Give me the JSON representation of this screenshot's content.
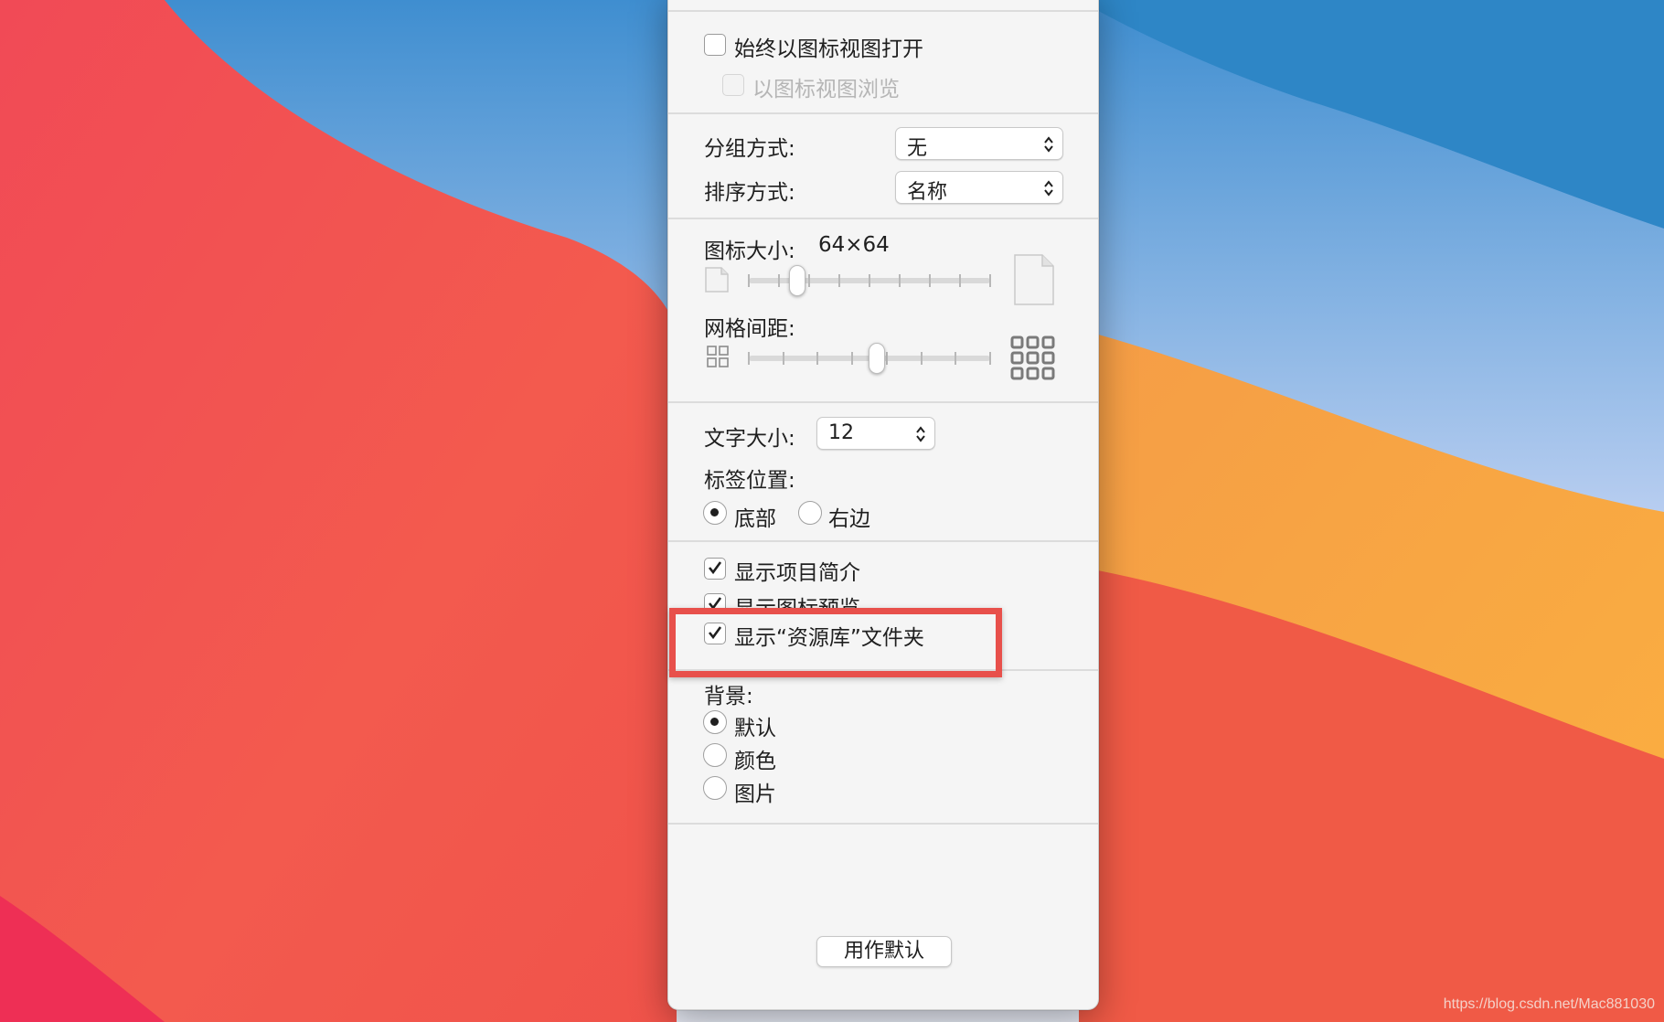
{
  "view_options": {
    "always_open_icon_view": {
      "label": "始终以图标视图打开",
      "checked": false
    },
    "browse_icon_view": {
      "label": "以图标视图浏览",
      "checked": false,
      "disabled": true
    },
    "group_by": {
      "label": "分组方式:",
      "value": "无"
    },
    "sort_by": {
      "label": "排序方式:",
      "value": "名称"
    },
    "icon_size": {
      "label": "图标大小:",
      "value": "64×64",
      "slider_fraction": 0.2
    },
    "grid_spacing": {
      "label": "网格间距:",
      "slider_fraction": 0.53
    },
    "text_size": {
      "label": "文字大小:",
      "value": "12"
    },
    "label_position": {
      "label": "标签位置:",
      "options": [
        {
          "label": "底部",
          "selected": true
        },
        {
          "label": "右边",
          "selected": false
        }
      ]
    },
    "show_item_info": {
      "label": "显示项目简介",
      "checked": true
    },
    "show_icon_preview": {
      "label": "显示图标预览",
      "checked": true
    },
    "show_library_folder": {
      "label": "显示“资源库”文件夹",
      "checked": true
    },
    "background": {
      "label": "背景:",
      "options": [
        {
          "label": "默认",
          "selected": true
        },
        {
          "label": "颜色",
          "selected": false
        },
        {
          "label": "图片",
          "selected": false
        }
      ]
    },
    "use_as_defaults_label": "用作默认"
  },
  "watermark": "https://blog.csdn.net/Mac881030",
  "colors": {
    "highlight": "#e8504b",
    "panel_bg": "#f5f5f5"
  }
}
